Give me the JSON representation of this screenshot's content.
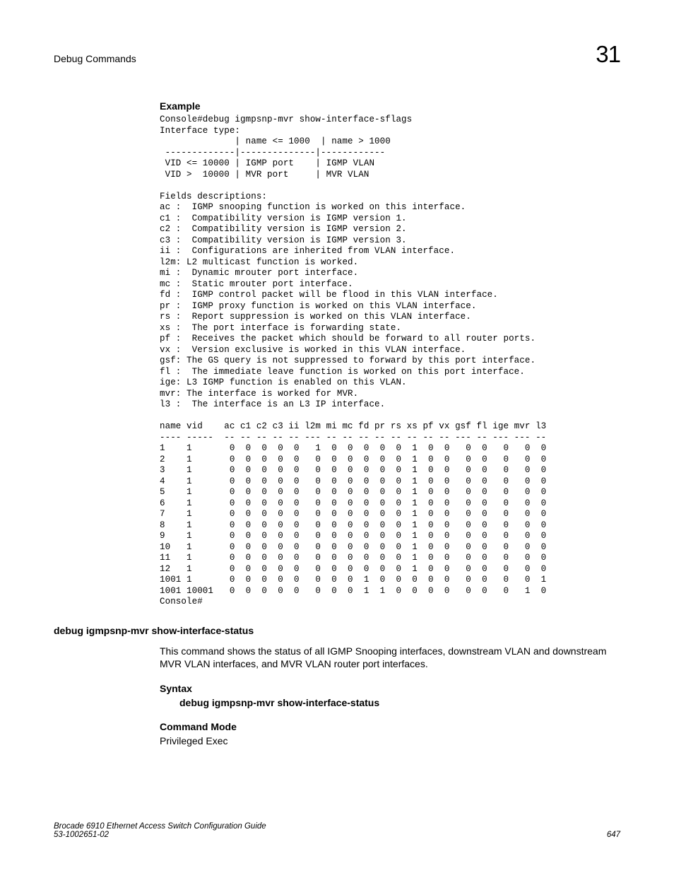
{
  "header": {
    "title": "Debug Commands",
    "chapter": "31"
  },
  "example": {
    "heading": "Example",
    "console": "Console#debug igmpsnp-mvr show-interface-sflags\nInterface type:\n              | name <= 1000  | name > 1000\n -------------|--------------|------------\n VID <= 10000 | IGMP port    | IGMP VLAN\n VID >  10000 | MVR port     | MVR VLAN\n\nFields descriptions:\nac :  IGMP snooping function is worked on this interface.\nc1 :  Compatibility version is IGMP version 1.\nc2 :  Compatibility version is IGMP version 2.\nc3 :  Compatibility version is IGMP version 3.\nii :  Configurations are inherited from VLAN interface.\nl2m: L2 multicast function is worked.\nmi :  Dynamic mrouter port interface.\nmc :  Static mrouter port interface.\nfd :  IGMP control packet will be flood in this VLAN interface.\npr :  IGMP proxy function is worked on this VLAN interface.\nrs :  Report suppression is worked on this VLAN interface.\nxs :  The port interface is forwarding state.\npf :  Receives the packet which should be forward to all router ports.\nvx :  Version exclusive is worked in this VLAN interface.\ngsf: The GS query is not suppressed to forward by this port interface.\nfl :  The immediate leave function is worked on this port interface.\nige: L3 IGMP function is enabled on this VLAN.\nmvr: The interface is worked for MVR.\nl3 :  The interface is an L3 IP interface.\n\nname vid    ac c1 c2 c3 ii l2m mi mc fd pr rs xs pf vx gsf fl ige mvr l3\n---- -----  -- -- -- -- -- --- -- -- -- -- -- -- -- -- --- -- --- --- --\n1    1       0  0  0  0  0   1  0  0  0  0  0  1  0  0   0  0   0   0  0\n2    1       0  0  0  0  0   0  0  0  0  0  0  1  0  0   0  0   0   0  0\n3    1       0  0  0  0  0   0  0  0  0  0  0  1  0  0   0  0   0   0  0\n4    1       0  0  0  0  0   0  0  0  0  0  0  1  0  0   0  0   0   0  0\n5    1       0  0  0  0  0   0  0  0  0  0  0  1  0  0   0  0   0   0  0\n6    1       0  0  0  0  0   0  0  0  0  0  0  1  0  0   0  0   0   0  0\n7    1       0  0  0  0  0   0  0  0  0  0  0  1  0  0   0  0   0   0  0\n8    1       0  0  0  0  0   0  0  0  0  0  0  1  0  0   0  0   0   0  0\n9    1       0  0  0  0  0   0  0  0  0  0  0  1  0  0   0  0   0   0  0\n10   1       0  0  0  0  0   0  0  0  0  0  0  1  0  0   0  0   0   0  0\n11   1       0  0  0  0  0   0  0  0  0  0  0  1  0  0   0  0   0   0  0\n12   1       0  0  0  0  0   0  0  0  0  0  0  1  0  0   0  0   0   0  0\n1001 1       0  0  0  0  0   0  0  0  1  0  0  0  0  0   0  0   0   0  1\n1001 10001   0  0  0  0  0   0  0  0  1  1  0  0  0  0   0  0   0   1  0\nConsole#"
  },
  "command": {
    "title": "debug igmpsnp-mvr show-interface-status",
    "description": "This command shows the status of all IGMP Snooping interfaces, downstream VLAN and downstream MVR VLAN interfaces, and MVR VLAN router port interfaces.",
    "syntax_heading": "Syntax",
    "syntax_line": "debug igmpsnp-mvr show-interface-status",
    "mode_heading": "Command Mode",
    "mode_value": "Privileged Exec"
  },
  "footer": {
    "book": "Brocade 6910 Ethernet Access Switch Configuration Guide",
    "docnum": "53-1002651-02",
    "page": "647"
  }
}
